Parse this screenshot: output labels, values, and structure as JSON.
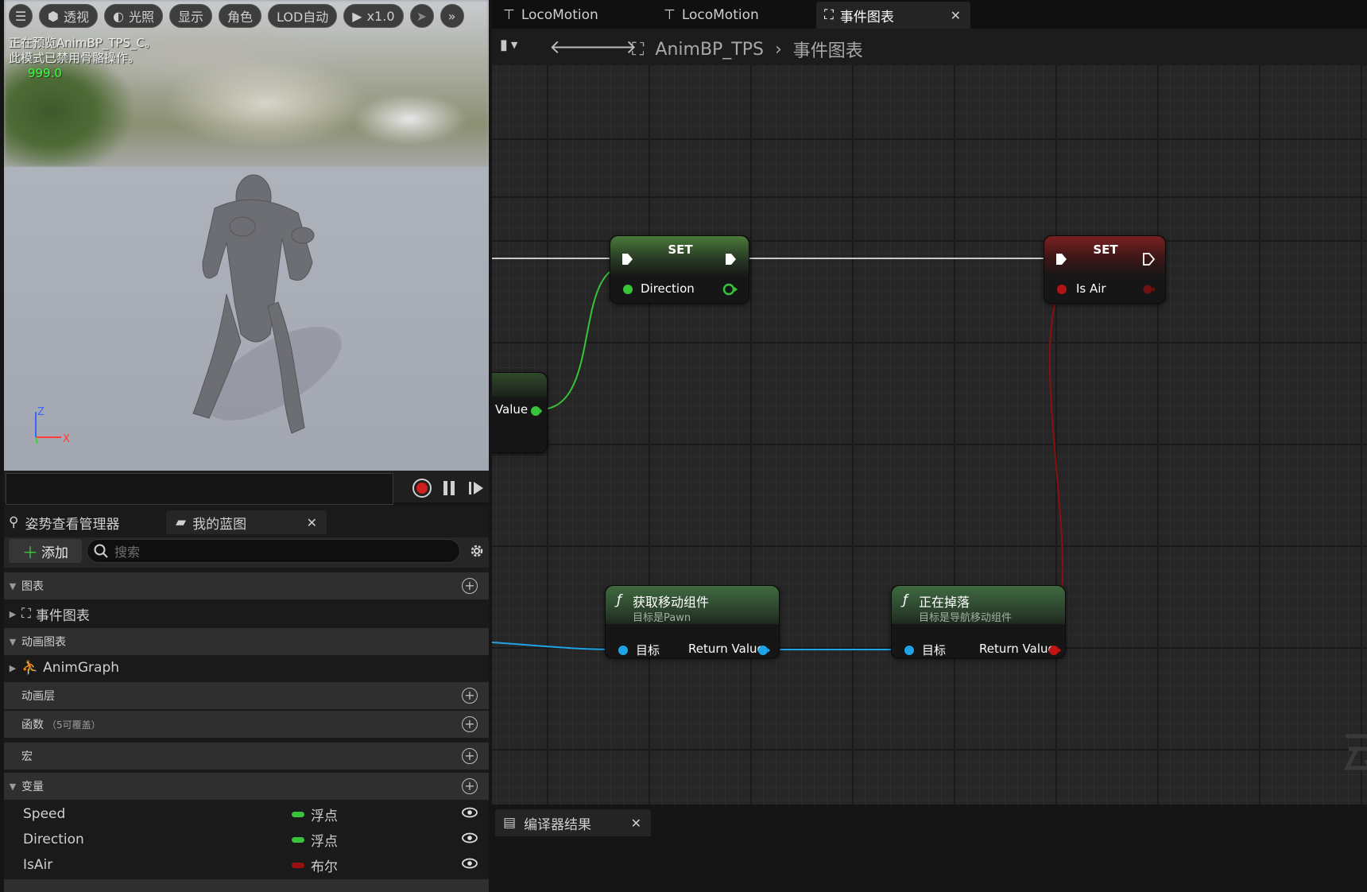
{
  "viewport": {
    "toolbar": {
      "perspective": "透视",
      "lighting": "光照",
      "show": "显示",
      "character": "角色",
      "lod": "LOD自动",
      "speed": "x1.0"
    },
    "info_line1": "正在预览AnimBP_TPS_C。",
    "info_line2": "此模式已禁用骨骼操作。",
    "fps": "999.0",
    "axis_z": "Z",
    "axis_x": "X"
  },
  "left_panel": {
    "tabs": [
      {
        "label": "姿势查看管理器"
      },
      {
        "label": "我的蓝图"
      }
    ],
    "add_label": "添加",
    "search_placeholder": "搜索",
    "sections": {
      "graphs": "图表",
      "event_graph": "事件图表",
      "anim_graphs": "动画图表",
      "anim_graph": "AnimGraph",
      "anim_layers": "动画层",
      "functions": "函数",
      "functions_hint": "（5可覆盖）",
      "macros": "宏",
      "variables": "变量"
    },
    "variables": [
      {
        "name": "Speed",
        "type": "浮点",
        "color": "#38c43a"
      },
      {
        "name": "Direction",
        "type": "浮点",
        "color": "#38c43a"
      },
      {
        "name": "IsAir",
        "type": "布尔",
        "color": "#9a1010"
      }
    ]
  },
  "graph_tabs": [
    {
      "label": "LocoMotion"
    },
    {
      "label": "LocoMotion"
    },
    {
      "label": "事件图表"
    }
  ],
  "breadcrumb": {
    "blueprint": "AnimBP_TPS",
    "graph": "事件图表"
  },
  "nodes": {
    "set_direction": {
      "title": "SET",
      "pin": "Direction"
    },
    "set_isair": {
      "title": "SET",
      "pin": "Is Air"
    },
    "partial": {
      "pin": "Value",
      "prefix": "ı"
    },
    "get_movement": {
      "title": "获取移动组件",
      "subtitle": "目标是Pawn",
      "input": "目标",
      "output": "Return Value"
    },
    "is_falling": {
      "title": "正在掉落",
      "subtitle": "目标是导航移动组件",
      "input": "目标",
      "output": "Return Value"
    }
  },
  "colors": {
    "float_pin": "#38c43a",
    "bool_pin": "#9a1010",
    "object_pin": "#1fa3e6"
  },
  "compiler": {
    "tab_label": "编译器结果"
  }
}
